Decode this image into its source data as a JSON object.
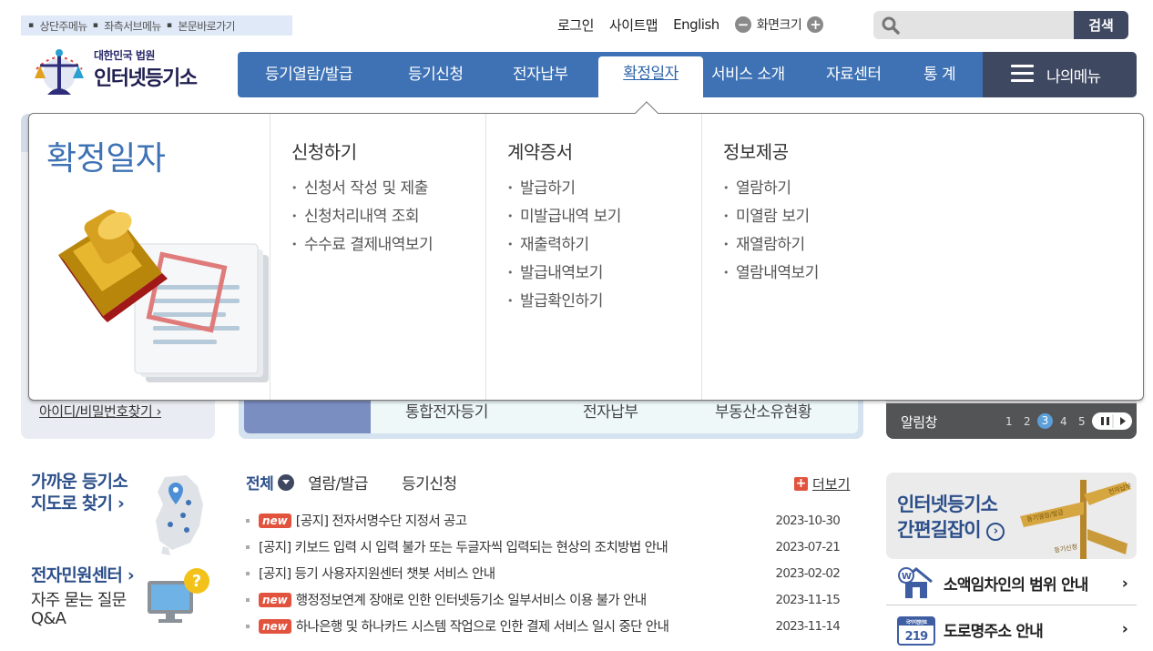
{
  "skip_nav": [
    "상단주메뉴",
    "좌측서브메뉴",
    "본문바로가기"
  ],
  "util": {
    "login": "로그인",
    "sitemap": "사이트맵",
    "english": "English",
    "zoom_label": "화면크기",
    "zoom_minus": "−",
    "zoom_plus": "+"
  },
  "search": {
    "placeholder": "",
    "button": "검색"
  },
  "logo": {
    "org": "대한민국 법원",
    "name": "인터넷등기소"
  },
  "gnb": [
    {
      "label": "등기열람/발급"
    },
    {
      "label": "등기신청"
    },
    {
      "label": "전자납부"
    },
    {
      "label": "확정일자",
      "active": true
    },
    {
      "label": "서비스 소개"
    },
    {
      "label": "자료센터"
    },
    {
      "label": "통 계"
    }
  ],
  "mymenu": "나의메뉴",
  "mega": {
    "title": "확정일자",
    "columns": [
      {
        "heading": "신청하기",
        "items": [
          "신청서 작성 및 제출",
          "신청처리내역 조회",
          "수수료 결제내역보기"
        ]
      },
      {
        "heading": "계약증서",
        "items": [
          "발급하기",
          "미발급내역 보기",
          "재출력하기",
          "발급내역보기",
          "발급확인하기"
        ]
      },
      {
        "heading": "정보제공",
        "items": [
          "열람하기",
          "미열람 보기",
          "재열람하기",
          "열람내역보기"
        ]
      }
    ]
  },
  "login_box": {
    "find_id": "아이디/비밀번호찾기 ›"
  },
  "quick": [
    "통합전자등기",
    "전자납부",
    "부동산소유현황"
  ],
  "alarm": {
    "title": "알림창",
    "pages": [
      "1",
      "2",
      "3",
      "4",
      "5"
    ],
    "current": "3"
  },
  "left_links": {
    "nearby": [
      "가까운 등기소",
      "지도로 찾기 ›"
    ],
    "ecenter": "전자민원센터 ›",
    "faq": [
      "자주 묻는 질문",
      "Q&A"
    ]
  },
  "notice_tabs": [
    "전체",
    "열람/발급",
    "등기신청"
  ],
  "more": "더보기",
  "notices": [
    {
      "new": true,
      "title": "[공지] 전자서명수단 지정서 공고",
      "date": "2023-10-30"
    },
    {
      "new": false,
      "title": "[공지] 키보드 입력 시 입력 불가 또는 두글자씩 입력되는 현상의 조치방법 안내",
      "date": "2023-07-21"
    },
    {
      "new": false,
      "title": "[공지] 등기 사용자지원센터 챗봇 서비스 안내",
      "date": "2023-02-02"
    },
    {
      "new": true,
      "title": "행정정보연계 장애로 인한 인터넷등기소 일부서비스 이용 불가 안내",
      "date": "2023-11-15"
    },
    {
      "new": true,
      "title": "하나은행 및 하나카드 시스템 작업으로 인한 결제 서비스 일시 중단 안내",
      "date": "2023-11-14"
    }
  ],
  "new_badge": "new",
  "guide": {
    "line1": "인터넷등기소",
    "line2": "간편길잡이",
    "sign1": "등기열람/발급",
    "sign2": "등기신청",
    "sign3": "전자납부"
  },
  "links": [
    "소액임차인의 범위 안내",
    "도로명주소 안내"
  ],
  "road_sign": {
    "top": "국가지점번호",
    "num": "219"
  },
  "colors": {
    "primary": "#3e72b5",
    "dark": "#3f4861",
    "accent": "#e2533e"
  }
}
